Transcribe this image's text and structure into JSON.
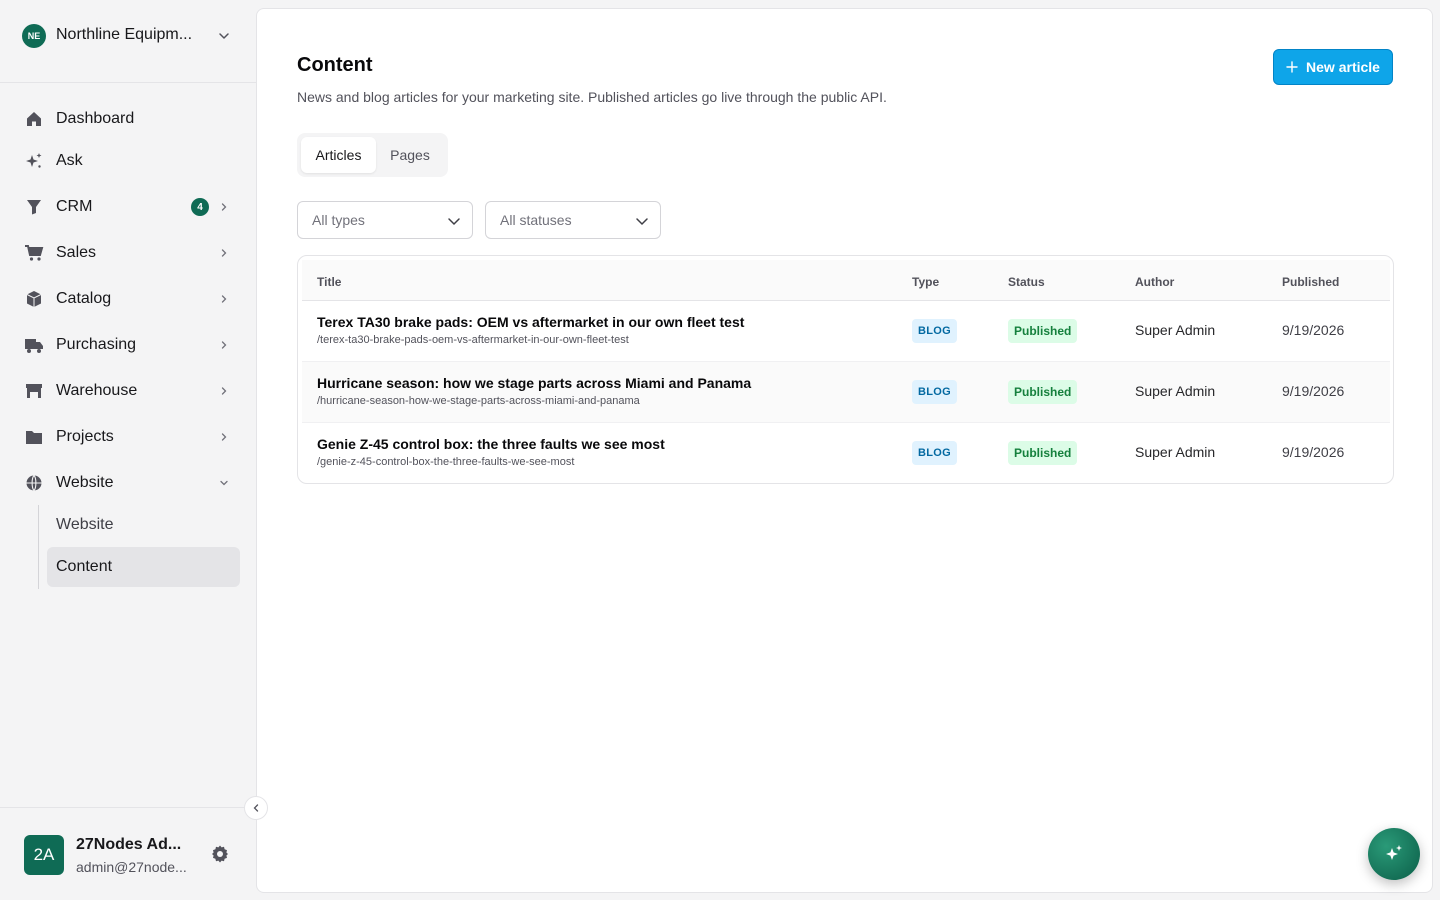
{
  "org": {
    "initials": "NE",
    "name": "Northline Equipm..."
  },
  "nav": {
    "items": [
      {
        "label": "Dashboard",
        "icon": "home-icon"
      },
      {
        "label": "Ask",
        "icon": "sparkles-icon"
      },
      {
        "label": "CRM",
        "icon": "funnel-icon",
        "badge": "4"
      },
      {
        "label": "Sales",
        "icon": "cart-icon"
      },
      {
        "label": "Catalog",
        "icon": "box-icon"
      },
      {
        "label": "Purchasing",
        "icon": "truck-icon"
      },
      {
        "label": "Warehouse",
        "icon": "warehouse-icon"
      },
      {
        "label": "Projects",
        "icon": "folder-icon"
      },
      {
        "label": "Website",
        "icon": "globe-icon"
      }
    ],
    "website_sub": [
      {
        "label": "Website"
      },
      {
        "label": "Content"
      }
    ]
  },
  "user": {
    "initials": "2A",
    "name": "27Nodes Ad...",
    "email": "admin@27node..."
  },
  "page": {
    "title": "Content",
    "description": "News and blog articles for your marketing site. Published articles go live through the public API.",
    "new_button": "New article",
    "tabs": [
      "Articles",
      "Pages"
    ],
    "active_tab": "Articles",
    "filters": {
      "type_placeholder": "All types",
      "status_placeholder": "All statuses"
    }
  },
  "table": {
    "columns": [
      "Title",
      "Type",
      "Status",
      "Author",
      "Published"
    ],
    "rows": [
      {
        "title": "Terex TA30 brake pads: OEM vs aftermarket in our own fleet test",
        "slug": "/terex-ta30-brake-pads-oem-vs-aftermarket-in-our-own-fleet-test",
        "type": "BLOG",
        "status": "Published",
        "author": "Super Admin",
        "published": "9/19/2026"
      },
      {
        "title": "Hurricane season: how we stage parts across Miami and Panama",
        "slug": "/hurricane-season-how-we-stage-parts-across-miami-and-panama",
        "type": "BLOG",
        "status": "Published",
        "author": "Super Admin",
        "published": "9/19/2026"
      },
      {
        "title": "Genie Z-45 control box: the three faults we see most",
        "slug": "/genie-z-45-control-box-the-three-faults-we-see-most",
        "type": "BLOG",
        "status": "Published",
        "author": "Super Admin",
        "published": "9/19/2026"
      }
    ]
  },
  "colors": {
    "brand": "#0f6b55",
    "primary_button": "#0ea5e9",
    "type_badge": "#e0f2fe",
    "status_badge": "#dcfce7"
  }
}
